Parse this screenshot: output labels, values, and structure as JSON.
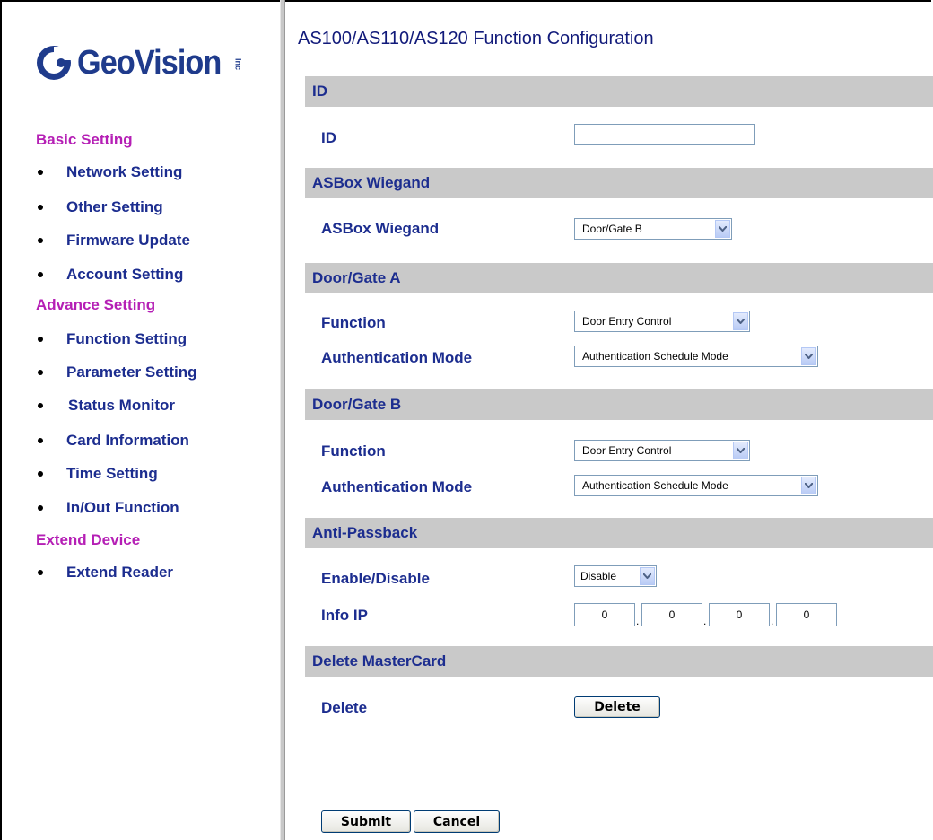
{
  "brand": {
    "name": "GeoVision",
    "suffix": "inc",
    "color": "#1f3b8c"
  },
  "colors": {
    "section_heading": "#b51fb5",
    "nav_text": "#1c2d8f",
    "bar_bg": "#c9c9c9"
  },
  "sidebar": {
    "groups": [
      {
        "heading": "Basic Setting",
        "items": [
          "Network Setting",
          "Other Setting",
          "Firmware Update",
          "Account Setting"
        ]
      },
      {
        "heading": "Advance Setting",
        "items": [
          "Function Setting",
          "Parameter Setting",
          "Status Monitor",
          "Card Information",
          "Time Setting",
          "In/Out Function"
        ]
      },
      {
        "heading": "Extend Device",
        "items": [
          "Extend Reader"
        ]
      }
    ]
  },
  "main": {
    "title": "AS100/AS110/AS120 Function Configuration",
    "sections": {
      "id": {
        "header": "ID",
        "field_label": "ID",
        "value": ""
      },
      "wiegand": {
        "header": "ASBox Wiegand",
        "field_label": "ASBox Wiegand",
        "value": "Door/Gate B"
      },
      "door_a": {
        "header": "Door/Gate A",
        "function_label": "Function",
        "function_value": "Door Entry Control",
        "auth_label": "Authentication Mode",
        "auth_value": "Authentication Schedule Mode"
      },
      "door_b": {
        "header": "Door/Gate B",
        "function_label": "Function",
        "function_value": "Door Entry Control",
        "auth_label": "Authentication Mode",
        "auth_value": "Authentication Schedule Mode"
      },
      "anti_passback": {
        "header": "Anti-Passback",
        "enable_label": "Enable/Disable",
        "enable_value": "Disable",
        "ip_label": "Info IP",
        "ip": [
          "0",
          "0",
          "0",
          "0"
        ]
      },
      "delete_master": {
        "header": "Delete MasterCard",
        "delete_label": "Delete",
        "delete_button": "Delete"
      }
    },
    "buttons": {
      "submit": "Submit",
      "cancel": "Cancel"
    }
  }
}
